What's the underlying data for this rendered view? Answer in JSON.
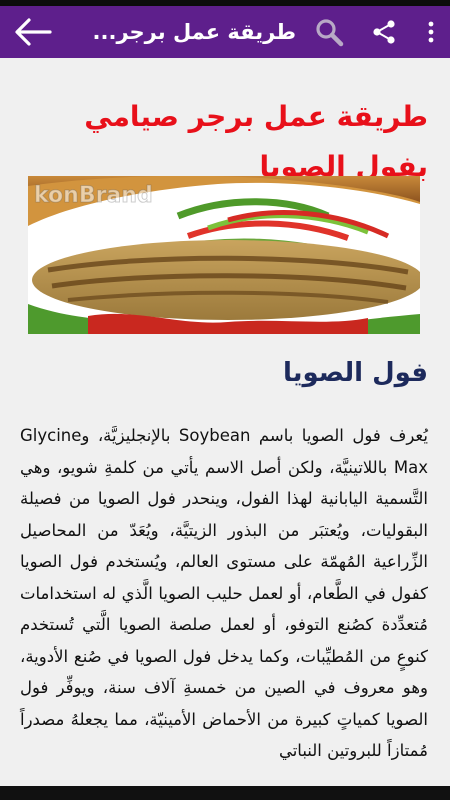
{
  "appbar": {
    "title": "طريقة عمل برجر...",
    "icons": [
      "back-arrow-icon",
      "search-icon",
      "share-icon",
      "more-vert-icon"
    ]
  },
  "article": {
    "title": "طريقة عمل برجر صيامي بفول الصويا",
    "image_watermark": "konBrand",
    "section_heading": "فول الصويا",
    "paragraph": "يُعرف فول الصويا باسم Soybean بالإنجليزيَّة، وGlycine Max باللاتينيَّة، ولكن أصل الاسم يأتي من كلمةِ شويو، وهي التَّسمية اليابانية لهذا الفول، وينحدر فول الصويا من فصيلة البقوليات، ويُعتبَر من البذور الزيتيَّة، ويُعَدّ من المحاصيل الزِّراعية المُهمّة على مستوى العالم، ويُستخدم فول الصويا كفول في الطَّعام، أو لعمل حليب الصويا الَّذي له استخدامات مُتعدِّدة كصُنع التوفو، أو لعمل صلصة الصويا الَّتي تُستخدم كنوعٍ من المُطيِّبات، وكما يدخل فول الصويا في صُنع الأدوية، وهو معروف في الصين من خمسةِ آلاف سنة، ويوفِّر فول الصويا كمياتٍ كبيرة من الأحماض الأمينيّة، مما يجعلهُ مصدراً مُمتازاً للبروتين النباتي"
  },
  "colors": {
    "appbar": "#5e1f8c",
    "title": "#e8101a",
    "heading": "#1d2a5c"
  }
}
